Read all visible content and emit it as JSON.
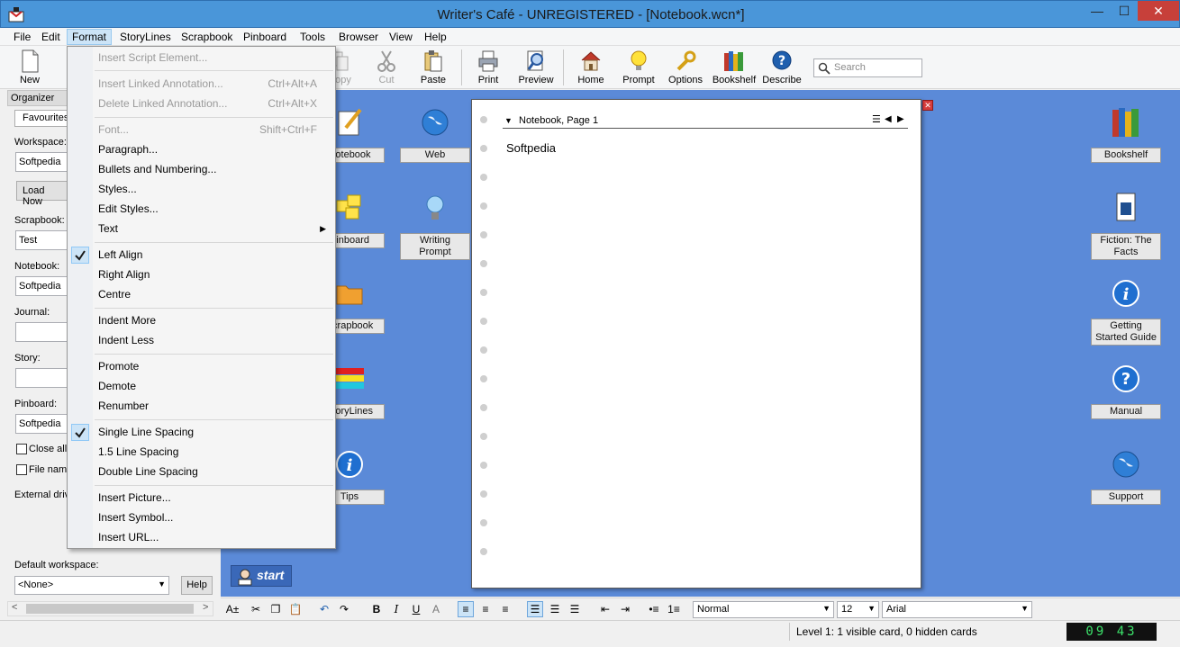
{
  "window": {
    "title": "Writer's Café - UNREGISTERED - [Notebook.wcn*]",
    "min": "—",
    "max": "☐",
    "close": "✕"
  },
  "menubar": [
    "File",
    "Edit",
    "Format",
    "StoryLines",
    "Scrapbook",
    "Pinboard",
    "Tools",
    "Browser",
    "View",
    "Help"
  ],
  "toolbar": {
    "new": "New",
    "copy": "Copy",
    "cut": "Cut",
    "paste": "Paste",
    "print": "Print",
    "preview": "Preview",
    "home": "Home",
    "prompt": "Prompt",
    "options": "Options",
    "bookshelf": "Bookshelf",
    "describe": "Describe",
    "search_placeholder": "Search"
  },
  "organizer": {
    "title": "Organizer",
    "tab": "Favourites",
    "workspace_label": "Workspace:",
    "workspace_value": "Softpedia",
    "load_now": "Load Now",
    "scrapbook_label": "Scrapbook:",
    "scrapbook_value": "Test",
    "notebook_label": "Notebook:",
    "notebook_value": "Softpedia",
    "journal_label": "Journal:",
    "story_label": "Story:",
    "pinboard_label": "Pinboard:",
    "pinboard_value": "Softpedia",
    "close_all": "Close all",
    "file_name": "File name",
    "external_drives": "External drive",
    "default_workspace_label": "Default workspace:",
    "default_workspace_value": "<None>",
    "help": "Help"
  },
  "desktop": {
    "notebook": "Notebook",
    "web": "Web",
    "pinboard": "Pinboard",
    "writing_prompt": "Writing Prompt",
    "scrapbook": "Scrapbook",
    "storylines": "StoryLines",
    "tips": "Tips",
    "bookshelf": "Bookshelf",
    "fiction": "Fiction: The Facts",
    "getting_started": "Getting Started Guide",
    "manual": "Manual",
    "support": "Support",
    "start": "start"
  },
  "notebook_page": {
    "header": "Notebook, Page 1",
    "text": "Softpedia"
  },
  "format_bar": {
    "style": "Normal",
    "size": "12",
    "font": "Arial"
  },
  "statusbar": {
    "status": "Level 1: 1 visible card, 0 hidden cards",
    "clock": "09 43"
  },
  "format_menu": {
    "insert_script_element": "Insert Script Element...",
    "insert_linked_annotation": "Insert Linked Annotation...",
    "insert_linked_annotation_sc": "Ctrl+Alt+A",
    "delete_linked_annotation": "Delete Linked Annotation...",
    "delete_linked_annotation_sc": "Ctrl+Alt+X",
    "font": "Font...",
    "font_sc": "Shift+Ctrl+F",
    "paragraph": "Paragraph...",
    "bullets": "Bullets and Numbering...",
    "styles": "Styles...",
    "edit_styles": "Edit Styles...",
    "text": "Text",
    "left_align": "Left Align",
    "right_align": "Right Align",
    "centre": "Centre",
    "indent_more": "Indent More",
    "indent_less": "Indent Less",
    "promote": "Promote",
    "demote": "Demote",
    "renumber": "Renumber",
    "single_spacing": "Single Line Spacing",
    "one_half_spacing": "1.5 Line Spacing",
    "double_spacing": "Double Line Spacing",
    "insert_picture": "Insert Picture...",
    "insert_symbol": "Insert Symbol...",
    "insert_url": "Insert URL..."
  }
}
